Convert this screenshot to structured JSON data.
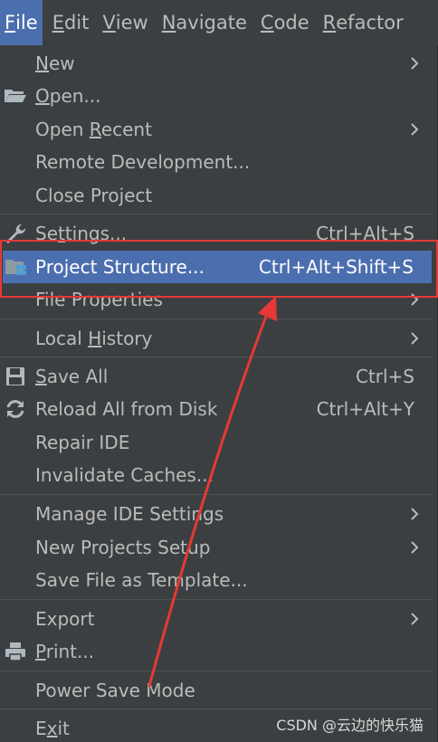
{
  "menubar": {
    "items": [
      {
        "pre": "",
        "acc": "F",
        "post": "ile"
      },
      {
        "pre": "",
        "acc": "E",
        "post": "dit"
      },
      {
        "pre": "",
        "acc": "V",
        "post": "iew"
      },
      {
        "pre": "",
        "acc": "N",
        "post": "avigate"
      },
      {
        "pre": "",
        "acc": "C",
        "post": "ode"
      },
      {
        "pre": "",
        "acc": "R",
        "post": "efactor"
      }
    ]
  },
  "file_menu": {
    "new": {
      "pre": "",
      "acc": "N",
      "post": "ew"
    },
    "open": {
      "pre": "",
      "acc": "O",
      "post": "pen..."
    },
    "open_recent": {
      "pre": "Open ",
      "acc": "R",
      "post": "ecent"
    },
    "remote_development": "Remote Development...",
    "close_project": "Close Project",
    "settings": {
      "pre": "Se",
      "acc": "t",
      "post": "tings...",
      "shortcut": "Ctrl+Alt+S"
    },
    "project_structure": {
      "label": "Project Structure...",
      "shortcut": "Ctrl+Alt+Shift+S"
    },
    "file_properties": "File Properties",
    "local_history": {
      "pre": "Local ",
      "acc": "H",
      "post": "istory"
    },
    "save_all": {
      "pre": "",
      "acc": "S",
      "post": "ave All",
      "shortcut": "Ctrl+S"
    },
    "reload_all": {
      "label": "Reload All from Disk",
      "shortcut": "Ctrl+Alt+Y"
    },
    "repair_ide": "Repair IDE",
    "invalidate_caches": "Invalidate Caches...",
    "manage_ide_settings": "Manage IDE Settings",
    "new_projects_setup": "New Projects Setup",
    "save_file_as_template": "Save File as Template...",
    "export": "Export",
    "print": {
      "pre": "",
      "acc": "P",
      "post": "rint..."
    },
    "power_save_mode": "Power Save Mode",
    "exit": {
      "pre": "E",
      "acc": "x",
      "post": "it"
    }
  },
  "watermark": "CSDN @云边的快乐猫",
  "colors": {
    "background": "#3c3f41",
    "selection": "#4b6eaf",
    "text": "#bbbbbb",
    "annotation": "#e53935"
  }
}
